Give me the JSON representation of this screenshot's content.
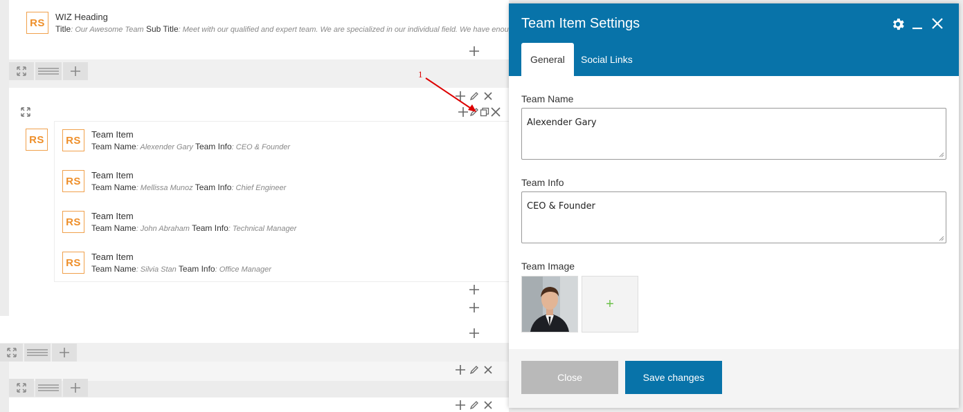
{
  "heading_element": {
    "name": "WIZ Heading",
    "logo_text": "RS",
    "title_label": "Title",
    "title_value": ": Our Awesome Team",
    "subtitle_label": "Sub Title",
    "subtitle_value": ": Meet with our qualified and expert team. We are specialized in our individual field. We have enough s"
  },
  "team_group": {
    "logo_text": "RS",
    "items": [
      {
        "title": "Team Item",
        "name_label": "Team Name",
        "name_value": ": Alexender Gary",
        "info_label": "Team Info",
        "info_value": ": CEO & Founder"
      },
      {
        "title": "Team Item",
        "name_label": "Team Name",
        "name_value": ": Mellissa Munoz",
        "info_label": "Team Info",
        "info_value": ": Chief Engineer"
      },
      {
        "title": "Team Item",
        "name_label": "Team Name",
        "name_value": ": John Abraham",
        "info_label": "Team Info",
        "info_value": ": Technical Manager"
      },
      {
        "title": "Team Item",
        "name_label": "Team Name",
        "name_value": ": Silvia Stan",
        "info_label": "Team Info",
        "info_value": ": Office Manager"
      }
    ]
  },
  "annotation": {
    "number": "1",
    "color": "#dd0000"
  },
  "modal": {
    "title": "Team Item Settings",
    "tabs": [
      {
        "label": "General",
        "active": true
      },
      {
        "label": "Social Links",
        "active": false
      }
    ],
    "fields": {
      "team_name": {
        "label": "Team Name",
        "value": "Alexender Gary"
      },
      "team_info": {
        "label": "Team Info",
        "value": "CEO & Founder"
      },
      "team_image": {
        "label": "Team Image",
        "add_symbol": "+"
      }
    },
    "buttons": {
      "close": "Close",
      "save": "Save changes"
    },
    "header_icons": [
      "gear-icon",
      "minimize-icon",
      "close-icon"
    ]
  },
  "colors": {
    "primary": "#0873a9",
    "logo_orange": "#ee8f2a",
    "add_green": "#6cc04a"
  }
}
